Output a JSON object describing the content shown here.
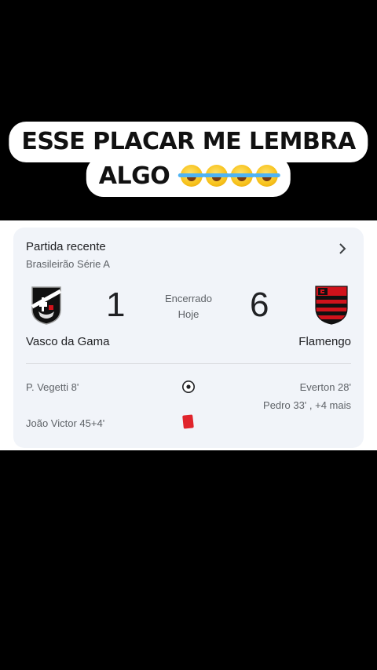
{
  "caption": {
    "line1": "ESSE PLACAR ME LEMBRA",
    "line2": "ALGO",
    "emoji": "face-with-tears-of-joy-icon x4"
  },
  "card": {
    "title": "Partida recente",
    "competition": "Brasileirão Série A",
    "home": {
      "name": "Vasco da Gama",
      "score": "1"
    },
    "away": {
      "name": "Flamengo",
      "score": "6"
    },
    "status_line1": "Encerrado",
    "status_line2": "Hoje",
    "events": {
      "home_goal": "P. Vegetti 8'",
      "away_goal_1": "Everton 28'",
      "away_goal_2": "Pedro 33' , +4 mais",
      "home_red_card": "João Victor 45+4'"
    },
    "colors": {
      "card_bg": "#f1f4f9",
      "red_card": "#e0242c",
      "flamengo_red": "#d0121b"
    }
  }
}
